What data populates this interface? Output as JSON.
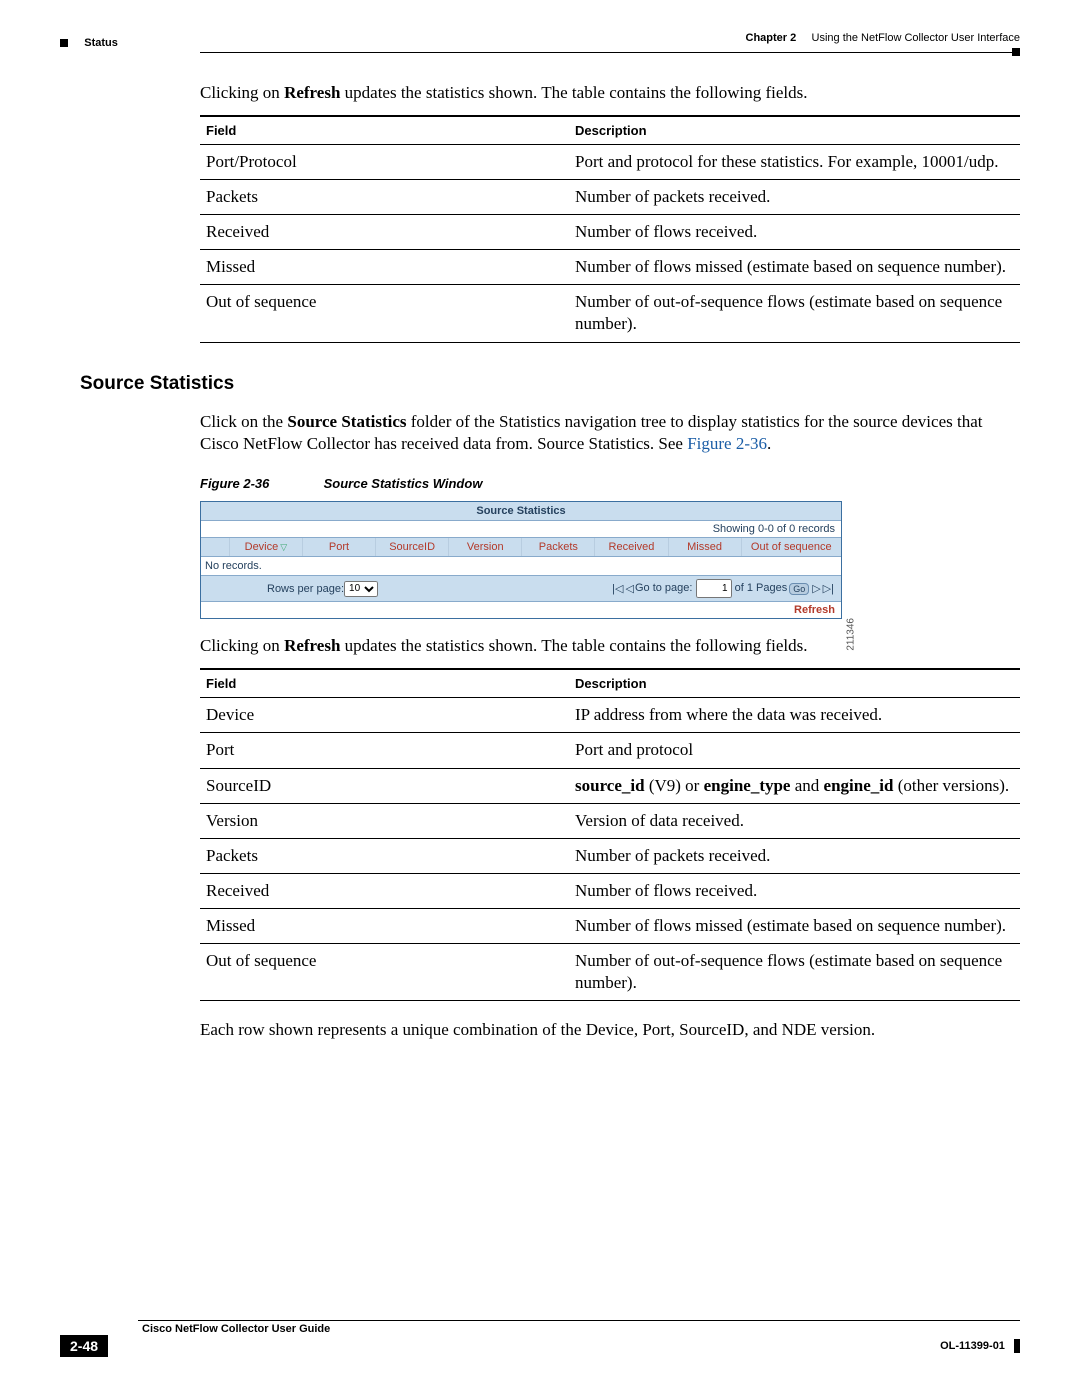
{
  "header": {
    "chapter_label": "Chapter 2",
    "chapter_title": "Using the NetFlow Collector User Interface",
    "section": "Status"
  },
  "intro1": {
    "pre": "Clicking on ",
    "bold": "Refresh",
    "post": " updates the statistics shown. The table contains the following fields."
  },
  "table1": {
    "hdr_field": "Field",
    "hdr_desc": "Description",
    "rows": [
      {
        "f": "Port/Protocol",
        "d": "Port and protocol for these statistics. For example, 10001/udp."
      },
      {
        "f": "Packets",
        "d": "Number of packets received."
      },
      {
        "f": "Received",
        "d": "Number of flows received."
      },
      {
        "f": "Missed",
        "d": "Number of flows missed (estimate based on sequence number)."
      },
      {
        "f": "Out of sequence",
        "d": "Number of out-of-sequence flows (estimate based on sequence number)."
      }
    ]
  },
  "heading": "Source Statistics",
  "para2": {
    "p1": "Click on the ",
    "b1": "Source Statistics",
    "p2": " folder of the Statistics navigation tree to display statistics for the source devices that Cisco NetFlow Collector has received data from. Source Statistics. See ",
    "link": "Figure 2-36",
    "p3": "."
  },
  "figcap": {
    "num": "Figure 2-36",
    "title": "Source Statistics Window"
  },
  "screenshot": {
    "title": "Source Statistics",
    "showing": "Showing 0-0 of 0 records",
    "cols": [
      "",
      "Device",
      "Port",
      "SourceID",
      "Version",
      "Packets",
      "Received",
      "Missed",
      "Out of sequence"
    ],
    "body": "No records.",
    "rows_per_page_label": "Rows per page:",
    "rows_per_page_value": "10",
    "goto_label": "Go to page:",
    "goto_value": "1",
    "pages_label": "of 1 Pages",
    "go_btn": "Go",
    "refresh_btn": "Refresh",
    "img_id": "211346"
  },
  "intro2": {
    "pre": "Clicking on ",
    "bold": "Refresh",
    "post": " updates the statistics shown. The table contains the following fields."
  },
  "table2": {
    "hdr_field": "Field",
    "hdr_desc": "Description",
    "rows": [
      {
        "f": "Device",
        "d": "IP address from where the data was received."
      },
      {
        "f": "Port",
        "d": "Port and protocol"
      },
      {
        "f": "SourceID",
        "d_bold1": "source_id",
        "d_mid1": " (V9) or ",
        "d_bold2": "engine_type",
        "d_mid2": " and ",
        "d_bold3": "engine_id",
        "d_post": " (other versions)."
      },
      {
        "f": "Version",
        "d": "Version of data received."
      },
      {
        "f": "Packets",
        "d": "Number of packets received."
      },
      {
        "f": "Received",
        "d": "Number of flows received."
      },
      {
        "f": "Missed",
        "d": "Number of flows missed (estimate based on sequence number)."
      },
      {
        "f": "Out of sequence",
        "d": "Number of out-of-sequence flows (estimate based on sequence number)."
      }
    ]
  },
  "closing": "Each row shown represents a unique combination of the Device, Port, SourceID, and NDE version.",
  "footer": {
    "guide": "Cisco NetFlow Collector User Guide",
    "page": "2-48",
    "doc_id": "OL-11399-01"
  }
}
